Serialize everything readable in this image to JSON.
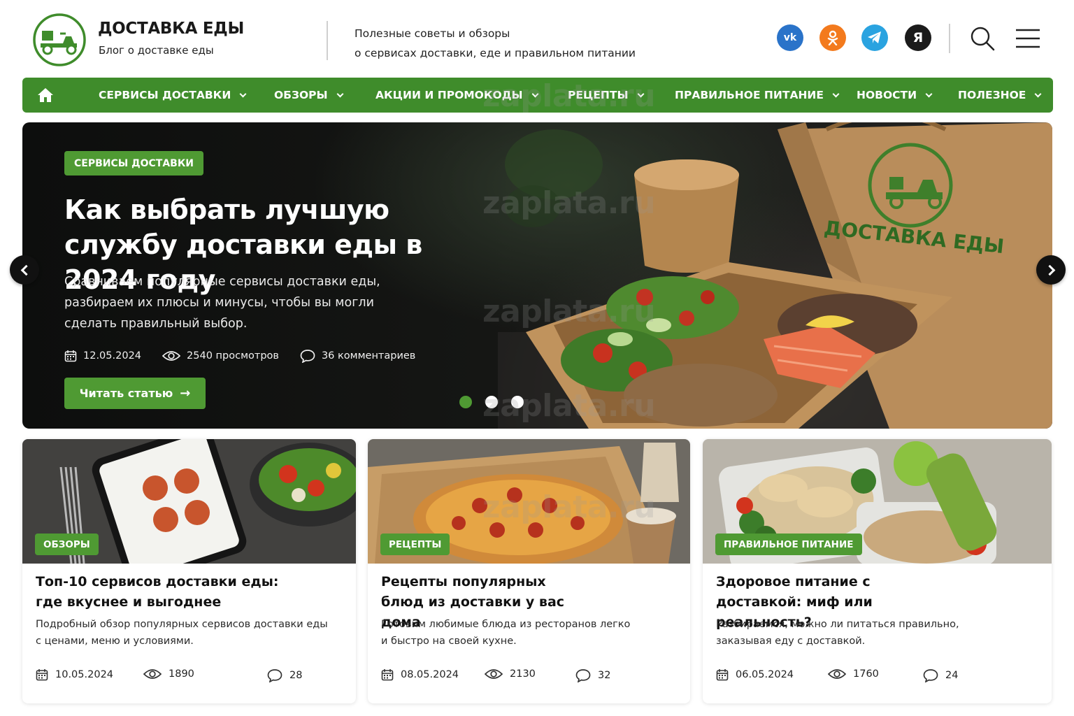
{
  "header": {
    "brand_title": "ДОСТАВКА ЕДЫ",
    "brand_subtitle": "Блог о доставке еды",
    "tagline_line1": "Полезные советы и обзоры",
    "tagline_line2": "о сервисах доставки, еде и правильном питании",
    "social": [
      {
        "name": "vk",
        "label": "vk",
        "color": "#2a73c9"
      },
      {
        "name": "ok",
        "label": "ok",
        "color": "#f37a1d"
      },
      {
        "name": "telegram",
        "label": "tg",
        "color": "#2aa3e0"
      },
      {
        "name": "yandex",
        "label": "Я",
        "color": "#1b1b1b"
      }
    ]
  },
  "nav": {
    "items": [
      {
        "label": "СЕРВИСЫ ДОСТАВКИ"
      },
      {
        "label": "ОБЗОРЫ"
      },
      {
        "label": "АКЦИИ И ПРОМОКОДЫ"
      },
      {
        "label": "РЕЦЕПТЫ"
      },
      {
        "label": "ПРАВИЛЬНОЕ ПИТАНИЕ"
      },
      {
        "label": "НОВОСТИ"
      },
      {
        "label": "ПОЛЕЗНОЕ"
      }
    ]
  },
  "hero": {
    "category": "СЕРВИСЫ ДОСТАВКИ",
    "title": "Как выбрать лучшую службу доставки еды в 2024 году",
    "description": "Сравниваем популярные сервисы доставки еды, разбираем их плюсы и минусы, чтобы вы могли сделать правильный выбор.",
    "date": "12.05.2024",
    "views": "2540 просмотров",
    "comments": "36 комментариев",
    "button_label": "Читать статью",
    "bag_text": "ДОСТАВКА ЕДЫ",
    "slides": 3,
    "active_slide": 1
  },
  "cards": [
    {
      "category": "ОБЗОРЫ",
      "title": "Топ-10 сервисов доставки еды: где вкуснее и выгоднее",
      "description": "Подробный обзор популярных сервисов доставки еды с ценами, меню и условиями.",
      "date": "10.05.2024",
      "views": "1890",
      "comments": "28"
    },
    {
      "category": "РЕЦЕПТЫ",
      "title": "Рецепты популярных блюд из доставки у вас дома",
      "description": "Готовим любимые блюда из ресторанов легко и быстро на своей кухне.",
      "date": "08.05.2024",
      "views": "2130",
      "comments": "32"
    },
    {
      "category": "ПРАВИЛЬНОЕ ПИТАНИЕ",
      "title": "Здоровое питание с доставкой: миф или реальность?",
      "description": "Разбираемся, можно ли питаться правильно, заказывая еду с доставкой.",
      "date": "06.05.2024",
      "views": "1760",
      "comments": "24"
    }
  ],
  "watermark": "zaplata.ru",
  "colors": {
    "brand_green": "#3f8c2b",
    "badge_green": "#4f9a33",
    "hero_dark": "#121312"
  }
}
